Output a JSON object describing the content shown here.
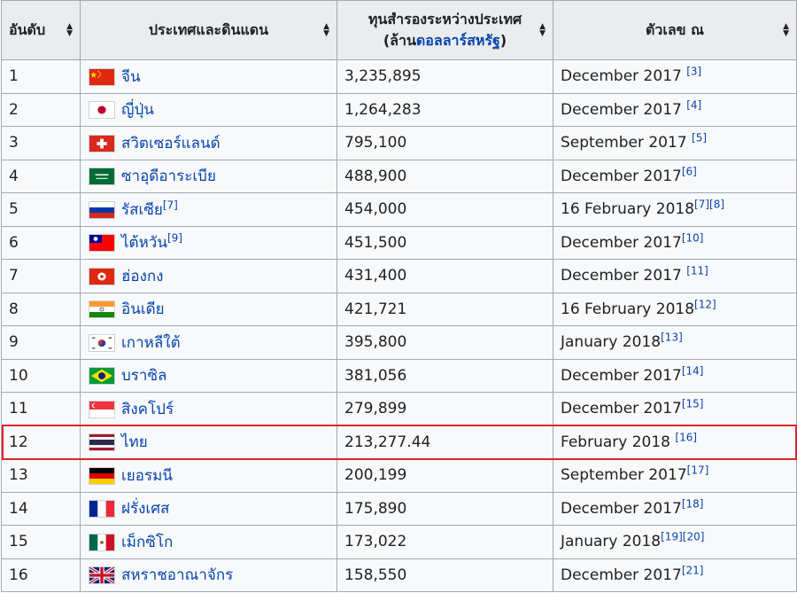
{
  "table": {
    "headers": {
      "rank": "อันดับ",
      "country": "ประเทศและดินแดน",
      "reserves_line1": "ทุนสำรองระหว่างประเทศ",
      "reserves_line2_pre": "(ล้าน",
      "reserves_line2_link": "ดอลลาร์สหรัฐ",
      "reserves_line2_post": ")",
      "date": "ตัวเลข ณ"
    },
    "rows": [
      {
        "rank": "1",
        "country": "จีน",
        "country_ref": "",
        "reserves": "3,235,895",
        "date": "December 2017 ",
        "refs": "[3]",
        "flag": "china-flag-icon"
      },
      {
        "rank": "2",
        "country": "ญี่ปุ่น",
        "country_ref": "",
        "reserves": "1,264,283",
        "date": "December 2017 ",
        "refs": "[4]",
        "flag": "japan-flag-icon"
      },
      {
        "rank": "3",
        "country": "สวิตเซอร์แลนด์",
        "country_ref": "",
        "reserves": "795,100",
        "date": "September 2017 ",
        "refs": "[5]",
        "flag": "switzerland-flag-icon"
      },
      {
        "rank": "4",
        "country": "ซาอุดีอาระเบีย",
        "country_ref": "",
        "reserves": "488,900",
        "date": "December 2017",
        "refs": "[6]",
        "flag": "saudi-arabia-flag-icon"
      },
      {
        "rank": "5",
        "country": "รัสเซีย",
        "country_ref": "[7]",
        "reserves": "454,000",
        "date": "16 February 2018",
        "refs": "[7][8]",
        "flag": "russia-flag-icon"
      },
      {
        "rank": "6",
        "country": "ไต้หวัน",
        "country_ref": "[9]",
        "reserves": "451,500",
        "date": "December 2017",
        "refs": "[10]",
        "flag": "taiwan-flag-icon"
      },
      {
        "rank": "7",
        "country": "ฮ่องกง",
        "country_ref": "",
        "reserves": "431,400",
        "date": "December 2017 ",
        "refs": "[11]",
        "flag": "hong-kong-flag-icon"
      },
      {
        "rank": "8",
        "country": "อินเดีย",
        "country_ref": "",
        "reserves": "421,721",
        "date": "16 February 2018",
        "refs": "[12]",
        "flag": "india-flag-icon"
      },
      {
        "rank": "9",
        "country": "เกาหลีใต้",
        "country_ref": "",
        "reserves": "395,800",
        "date": "January 2018",
        "refs": "[13]",
        "flag": "south-korea-flag-icon"
      },
      {
        "rank": "10",
        "country": "บราซิล",
        "country_ref": "",
        "reserves": "381,056",
        "date": "December 2017",
        "refs": "[14]",
        "flag": "brazil-flag-icon"
      },
      {
        "rank": "11",
        "country": "สิงคโปร์",
        "country_ref": "",
        "reserves": "279,899",
        "date": "December 2017",
        "refs": "[15]",
        "flag": "singapore-flag-icon"
      },
      {
        "rank": "12",
        "country": "ไทย",
        "country_ref": "",
        "reserves": "213,277.44",
        "date": "February 2018 ",
        "refs": "[16]",
        "flag": "thailand-flag-icon"
      },
      {
        "rank": "13",
        "country": "เยอรมนี",
        "country_ref": "",
        "reserves": "200,199",
        "date": "September 2017",
        "refs": "[17]",
        "flag": "germany-flag-icon"
      },
      {
        "rank": "14",
        "country": "ฝรั่งเศส",
        "country_ref": "",
        "reserves": "175,890",
        "date": "December 2017",
        "refs": "[18]",
        "flag": "france-flag-icon"
      },
      {
        "rank": "15",
        "country": "เม็กซิโก",
        "country_ref": "",
        "reserves": "173,022",
        "date": "January 2018",
        "refs": "[19][20]",
        "flag": "mexico-flag-icon"
      },
      {
        "rank": "16",
        "country": "สหราชอาณาจักร",
        "country_ref": "",
        "reserves": "158,550",
        "date": "December 2017",
        "refs": "[21]",
        "flag": "united-kingdom-flag-icon"
      }
    ],
    "highlighted_rank": "12"
  },
  "colors": {
    "link": "#0645ad",
    "header_bg": "#eaecf0",
    "cell_bg": "#f8f9fa",
    "border": "#a2a9b1",
    "highlight": "#e0242c"
  },
  "icons": {
    "sort": "sort-icon"
  }
}
